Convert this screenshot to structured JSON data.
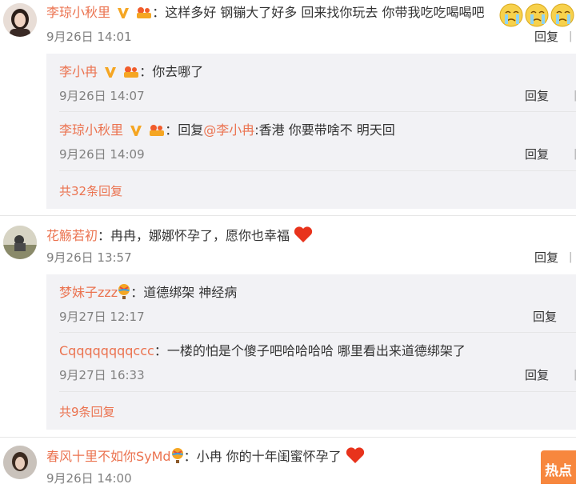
{
  "comments": [
    {
      "user": "李琼小秋里",
      "text": "：这样多好 钢镚大了好多 回来找你玩去 你带我吃吃喝喝吧",
      "time": "9月26日 14:01",
      "reply_label": "回复",
      "replies": [
        {
          "user": "李小冉",
          "text": "：你去哪了",
          "time": "9月26日 14:07",
          "reply_label": "回复"
        },
        {
          "user": "李琼小秋里",
          "text_prefix": "：回复",
          "mention": "@李小冉",
          "text": ":香港 你要带啥不 明天回",
          "time": "9月26日 14:09",
          "reply_label": "回复"
        }
      ],
      "more_replies": "共32条回复"
    },
    {
      "user": "花觞若初",
      "text": "：冉冉，娜娜怀孕了，愿你也幸福",
      "time": "9月26日 13:57",
      "reply_label": "回复",
      "replies": [
        {
          "user": "梦妹子zzz",
          "text": "：道德绑架 神经病",
          "time": "9月27日 12:17",
          "reply_label": "回复"
        },
        {
          "user": "Cqqqqqqqqccc",
          "text": "：一楼的怕是个傻子吧哈哈哈哈 哪里看出来道德绑架了",
          "time": "9月27日 16:33",
          "reply_label": "回复"
        }
      ],
      "more_replies": "共9条回复"
    },
    {
      "user": "春风十里不如你SyMd",
      "text": "：小冉 你的十年闺蜜怀孕了",
      "time": "9月26日 14:00"
    }
  ],
  "hot_button": "热点",
  "colors": {
    "username": "#eb7350",
    "thread_bg": "#f2f2f5",
    "hot": "#f7873e"
  }
}
